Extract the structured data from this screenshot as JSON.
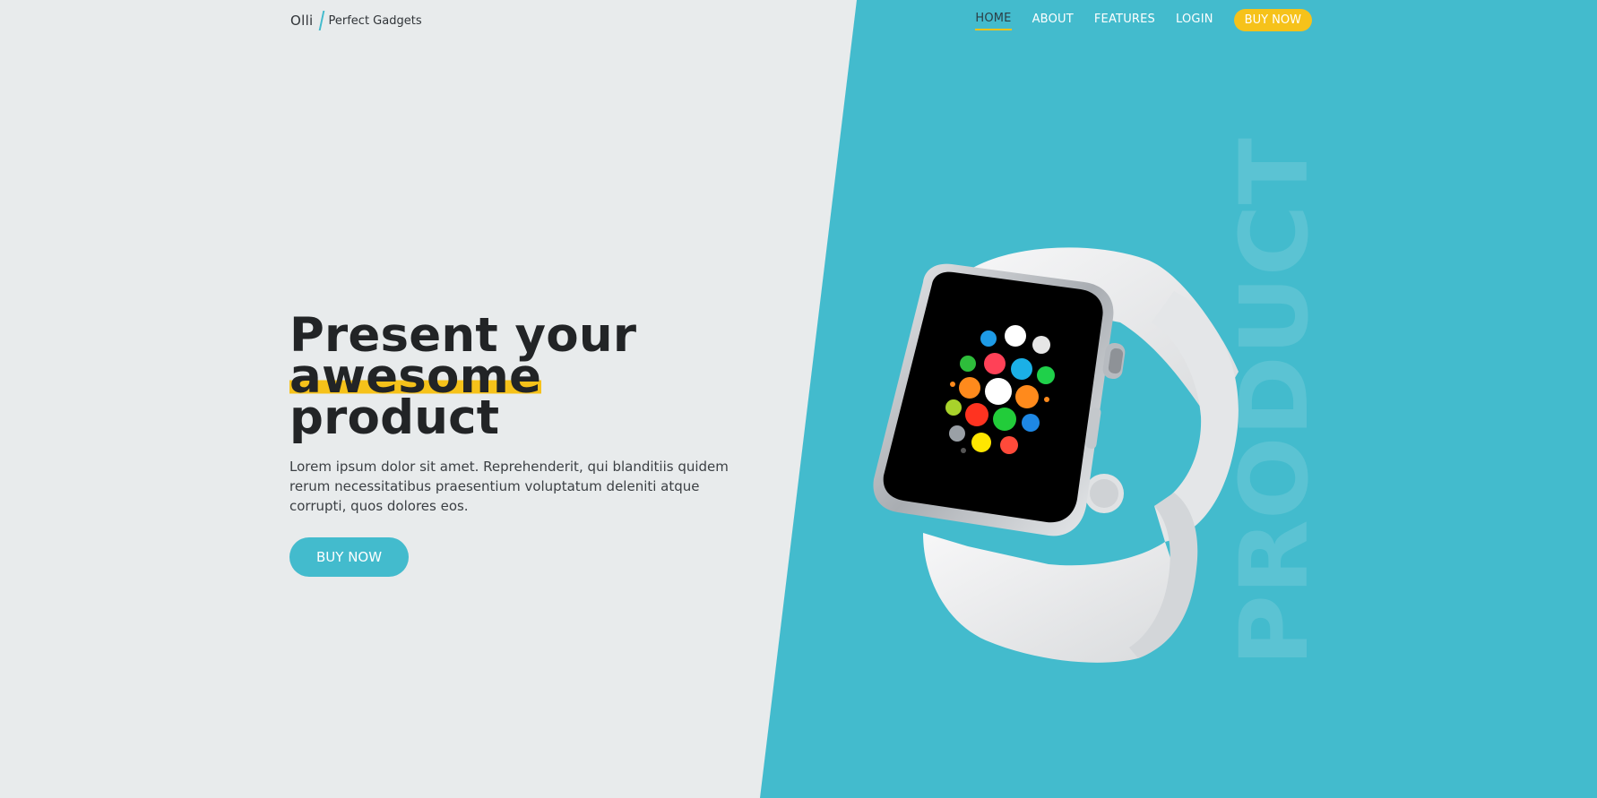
{
  "brand": {
    "name": "Olli",
    "tagline": "Perfect Gadgets"
  },
  "nav": {
    "items": [
      "HOME",
      "ABOUT",
      "FEATURES",
      "LOGIN"
    ],
    "active": "HOME",
    "cta": "BUY NOW"
  },
  "hero": {
    "title_line1": "Present your",
    "title_highlight": "awesome",
    "title_line3": "product",
    "body": "Lorem ipsum dolor sit amet. Reprehenderit, qui blanditiis quidem rerum necessitatibus praesentium voluptatum deleniti atque corrupti, quos dolores eos.",
    "cta": "BUY NOW"
  },
  "watermark": "PRODUCT",
  "colors": {
    "accent": "#43bbcd",
    "highlight": "#f6c21a",
    "background": "#e8ebec",
    "text": "#222426"
  }
}
